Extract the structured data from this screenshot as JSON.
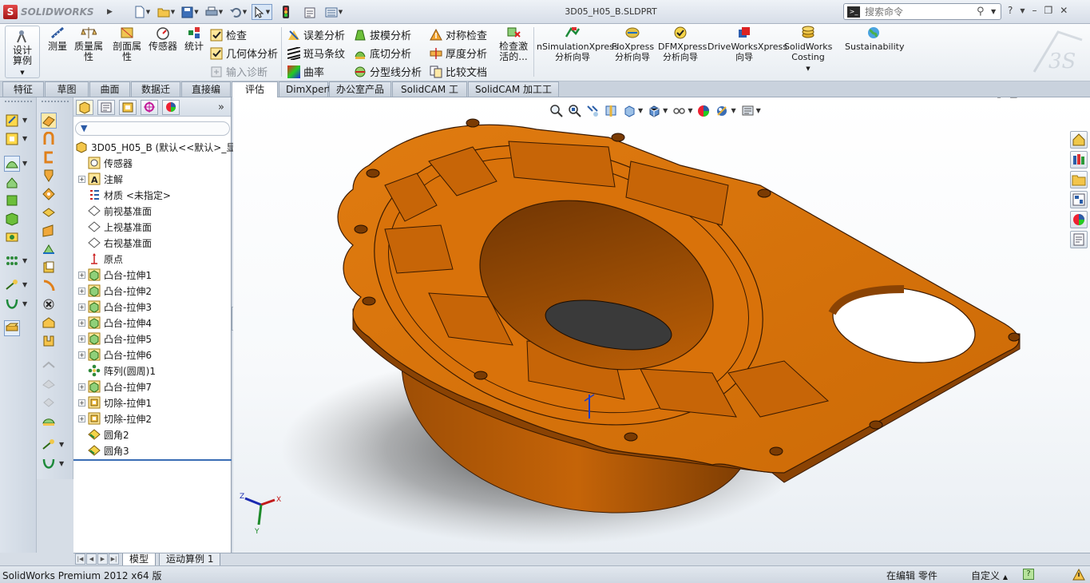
{
  "app": {
    "brand": "SOLIDWORKS",
    "doc_title": "3D05_H05_B.SLDPRT",
    "search_placeholder": "搜索命令"
  },
  "ribbon": {
    "design_study": "设计算例",
    "measure": "测量",
    "mass_props": "质量属性",
    "section_props": "剖面属性",
    "sensor": "传感器",
    "statistics": "统计",
    "check": "检查",
    "geometry_analysis": "几何体分析",
    "import_diagnostics": "输入诊断",
    "deviation_analysis": "误差分析",
    "zebra_stripes": "斑马条纹",
    "curvature": "曲率",
    "draft_analysis": "拔模分析",
    "undercut_analysis": "底切分析",
    "parting_line_analysis": "分型线分析",
    "symmetry_check": "对称检查",
    "thickness_analysis": "厚度分析",
    "compare_documents": "比较文档",
    "check_active": "检查激活的...",
    "simxpress": "nSimulationXpress 分析向导",
    "floxpress": "FloXpress 分析向导",
    "dfmxpress": "DFMXpress 分析向导",
    "driveworksxpress": "DriveWorksXpress 向导",
    "costing": "SolidWorks Costing",
    "sustainability": "Sustainability"
  },
  "command_tabs": [
    "特征",
    "草图",
    "曲面",
    "数据迁移",
    "直接编辑",
    "评估",
    "DimXpert",
    "办公室产品",
    "SolidCAM 工件",
    "SolidCAM 加工工程"
  ],
  "active_command_tab": "评估",
  "feature_tree": {
    "root": "3D05_H05_B  (默认<<默认>_显",
    "items": [
      {
        "label": "传感器",
        "icon": "sensor-icon",
        "expandable": false
      },
      {
        "label": "注解",
        "icon": "annotation-icon",
        "expandable": true
      },
      {
        "label": "材质 <未指定>",
        "icon": "material-icon",
        "expandable": false
      },
      {
        "label": "前视基准面",
        "icon": "plane-icon",
        "expandable": false
      },
      {
        "label": "上视基准面",
        "icon": "plane-icon",
        "expandable": false
      },
      {
        "label": "右视基准面",
        "icon": "plane-icon",
        "expandable": false
      },
      {
        "label": "原点",
        "icon": "origin-icon",
        "expandable": false
      },
      {
        "label": "凸台-拉伸1",
        "icon": "extrude-icon",
        "expandable": true
      },
      {
        "label": "凸台-拉伸2",
        "icon": "extrude-icon",
        "expandable": true
      },
      {
        "label": "凸台-拉伸3",
        "icon": "extrude-icon",
        "expandable": true
      },
      {
        "label": "凸台-拉伸4",
        "icon": "extrude-icon",
        "expandable": true
      },
      {
        "label": "凸台-拉伸5",
        "icon": "extrude-icon",
        "expandable": true
      },
      {
        "label": "凸台-拉伸6",
        "icon": "extrude-icon",
        "expandable": true
      },
      {
        "label": "阵列(圆周)1",
        "icon": "circular-pattern-icon",
        "expandable": false
      },
      {
        "label": "凸台-拉伸7",
        "icon": "extrude-icon",
        "expandable": true
      },
      {
        "label": "切除-拉伸1",
        "icon": "cut-extrude-icon",
        "expandable": true
      },
      {
        "label": "切除-拉伸2",
        "icon": "cut-extrude-icon",
        "expandable": true
      },
      {
        "label": "圆角2",
        "icon": "fillet-icon",
        "expandable": false
      },
      {
        "label": "圆角3",
        "icon": "fillet-icon",
        "expandable": false
      }
    ]
  },
  "bottom_tabs": [
    "模型",
    "运动算例 1"
  ],
  "active_bottom_tab": "模型",
  "status": {
    "version": "SolidWorks Premium 2012 x64 版",
    "editing": "在编辑 零件",
    "units": "自定义",
    "help": "?"
  },
  "colors": {
    "part": "#d9720a",
    "part_dark": "#8a4304",
    "accent": "#3a6db5"
  }
}
